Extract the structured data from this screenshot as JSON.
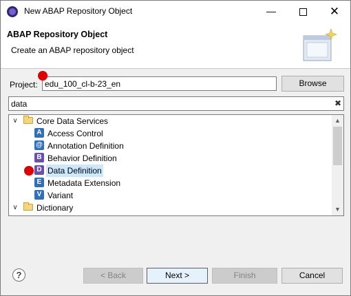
{
  "window": {
    "title": "New ABAP Repository Object"
  },
  "header": {
    "title": "ABAP Repository Object",
    "description": "Create an ABAP repository object"
  },
  "project": {
    "label": "Project:",
    "value": "edu_100_cl-b-23_en",
    "browse_label": "Browse"
  },
  "filter": {
    "value": "data"
  },
  "tree": {
    "groups": [
      {
        "label": "Core Data Services",
        "expanded": true,
        "items": [
          {
            "label": "Access Control",
            "icon": "access-control-icon",
            "glyph": "A"
          },
          {
            "label": "Annotation Definition",
            "icon": "annotation-definition-icon",
            "glyph": "@"
          },
          {
            "label": "Behavior Definition",
            "icon": "behavior-definition-icon",
            "glyph": "B"
          },
          {
            "label": "Data Definition",
            "icon": "data-definition-icon",
            "glyph": "D",
            "selected": true
          },
          {
            "label": "Metadata Extension",
            "icon": "metadata-extension-icon",
            "glyph": "E"
          },
          {
            "label": "Variant",
            "icon": "variant-icon",
            "glyph": "V"
          }
        ]
      },
      {
        "label": "Dictionary",
        "expanded": true,
        "items": []
      }
    ]
  },
  "buttons": {
    "back": "< Back",
    "next": "Next >",
    "finish": "Finish",
    "cancel": "Cancel"
  },
  "colors": {
    "selection": "#cce8ff",
    "marker": "#e00000",
    "focus_border": "#0078d7"
  }
}
